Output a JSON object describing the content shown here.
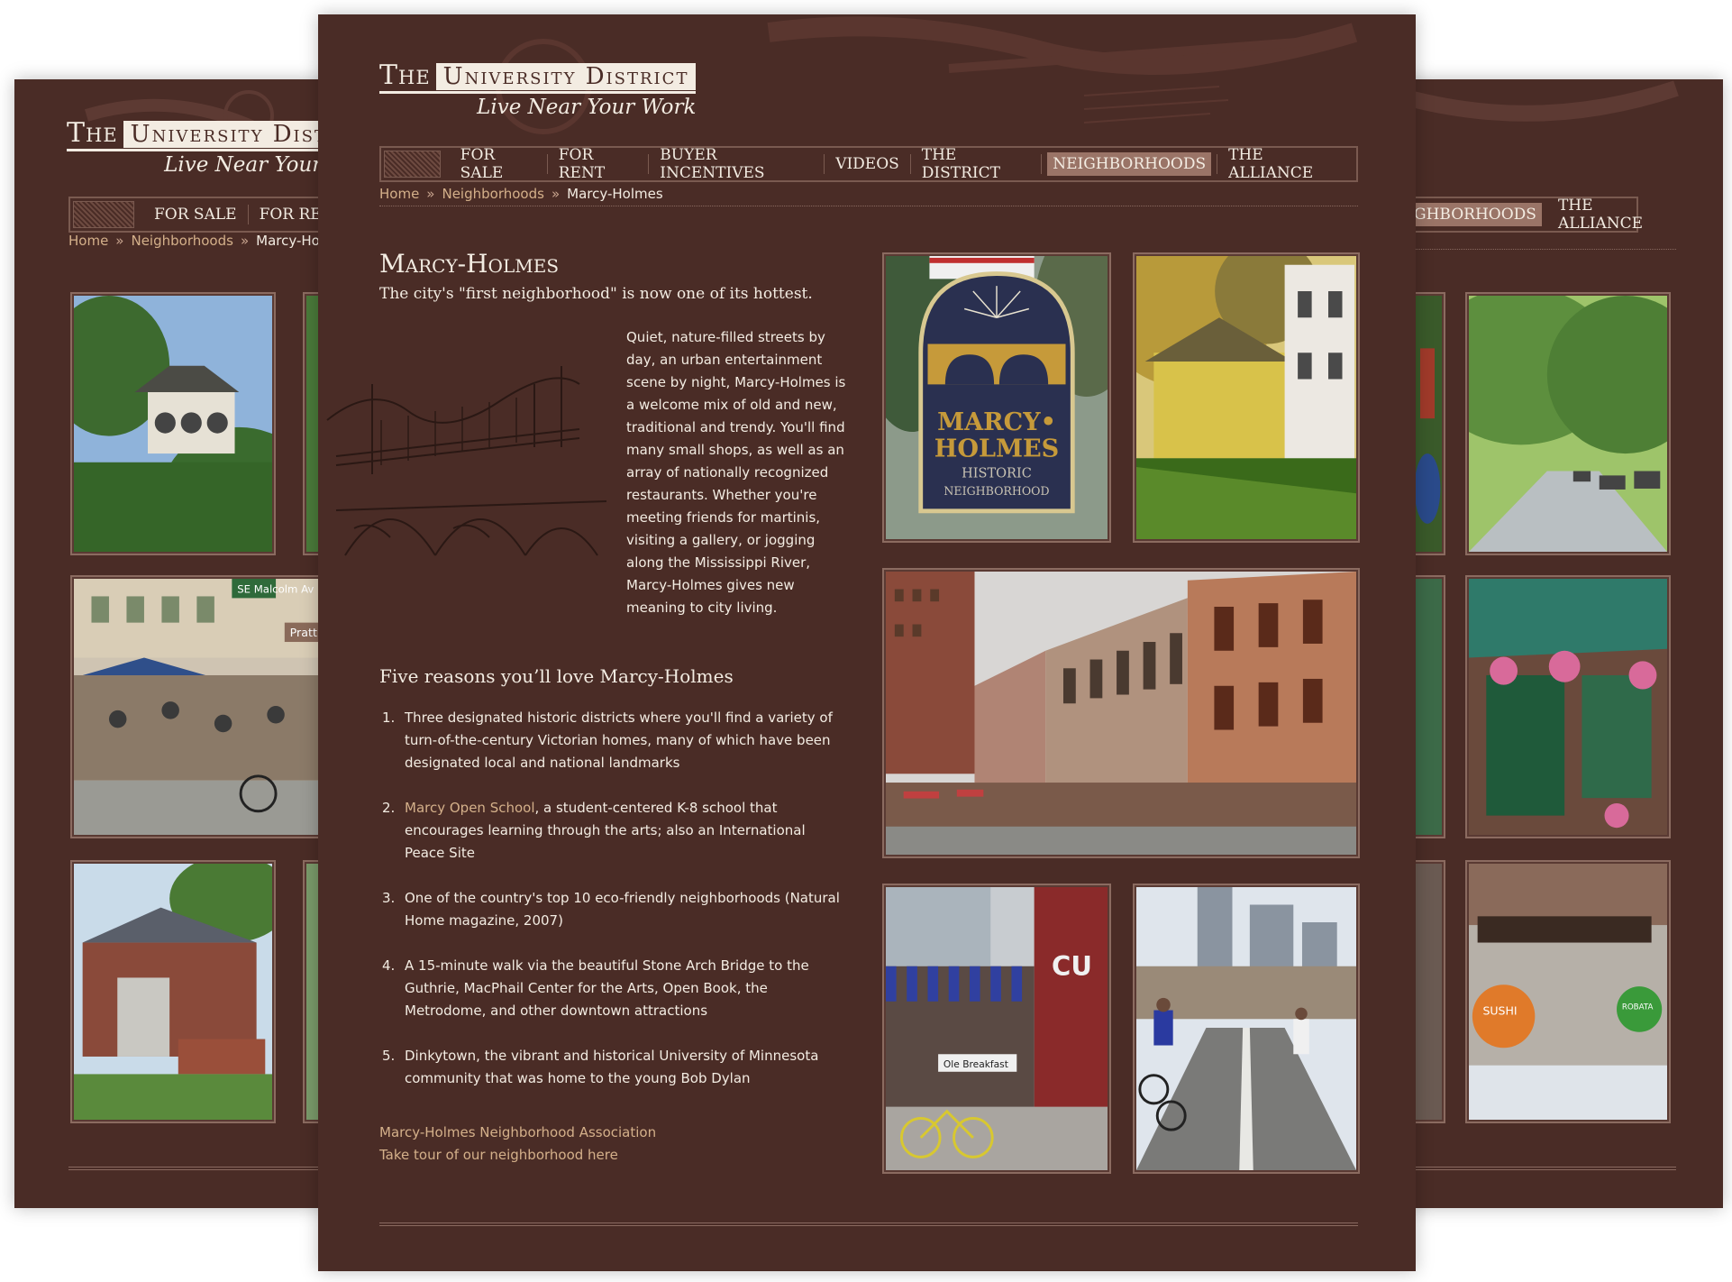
{
  "site": {
    "logo_the": "The",
    "logo_name": "University District",
    "logo_tagline": "Live Near Your Work"
  },
  "nav": {
    "items": [
      "For Sale",
      "For Rent",
      "Buyer Incentives",
      "Videos",
      "The District",
      "Neighborhoods",
      "The Alliance"
    ],
    "active": "Neighborhoods"
  },
  "breadcrumb": {
    "home": "Home",
    "section": "Neighborhoods",
    "current": "Marcy-Holmes",
    "separator": "»"
  },
  "main": {
    "title": "Marcy-Holmes",
    "subtitle": "The city's \"first neighborhood\" is now one of its hottest.",
    "intro_lines": [
      "Quiet, nature-filled streets by",
      "day, an urban entertainment",
      "scene by night, Marcy-Holmes is",
      "a welcome mix of old and new,",
      "traditional and trendy. You'll find",
      "many small shops, as well as an",
      "array of nationally recognized",
      "restaurants. Whether you're",
      "meeting friends for martinis,",
      "visiting a gallery, or jogging",
      "along the Mississippi River,",
      "Marcy-Holmes gives new",
      "meaning to city living."
    ],
    "reasons_heading": "Five reasons you’ll love Marcy-Holmes",
    "reasons": [
      {
        "num": "1.",
        "lines": [
          "Three designated historic districts where you'll find a variety of",
          "turn-of-the-century Victorian homes, many of which have been",
          "designated local and national landmarks"
        ]
      },
      {
        "num": "2.",
        "link": "Marcy Open School",
        "lines": [
          ", a student-centered K-8 school that",
          "encourages learning through the arts; also an International",
          "Peace Site"
        ]
      },
      {
        "num": "3.",
        "lines": [
          "One of the country's top 10 eco-friendly neighborhoods (Natural",
          "Home magazine, 2007)"
        ]
      },
      {
        "num": "4.",
        "lines": [
          "A 15-minute walk via the beautiful Stone Arch Bridge to the",
          "Guthrie, MacPhail Center for the Arts, Open Book, the",
          "Metrodome, and other downtown attractions"
        ]
      },
      {
        "num": "5.",
        "lines": [
          "Dinkytown, the vibrant and historical University of Minnesota",
          "community that was home to the young Bob Dylan"
        ]
      }
    ],
    "association_link": "Marcy-Holmes Neighborhood Association",
    "tour_link": "Take tour of our neighborhood here"
  },
  "photos": {
    "sign_line1": "MARCY•",
    "sign_line2": "HOLMES",
    "sign_line3": "HISTORIC",
    "sign_line4": "NEIGHBORHOOD",
    "street_sign": "SE Malcolm Av",
    "pratt_sign": "Pratt",
    "cafe_sign": "CU",
    "breakfast_sign": "Ole Breakfast",
    "sushi_sign": "SUSHI",
    "robata_sign": "ROBATA"
  },
  "colors": {
    "background": "#4a2c26",
    "text": "#f3ece2",
    "link": "#d4b08a",
    "active_nav": "#9a7467",
    "border": "#8b6b60"
  }
}
